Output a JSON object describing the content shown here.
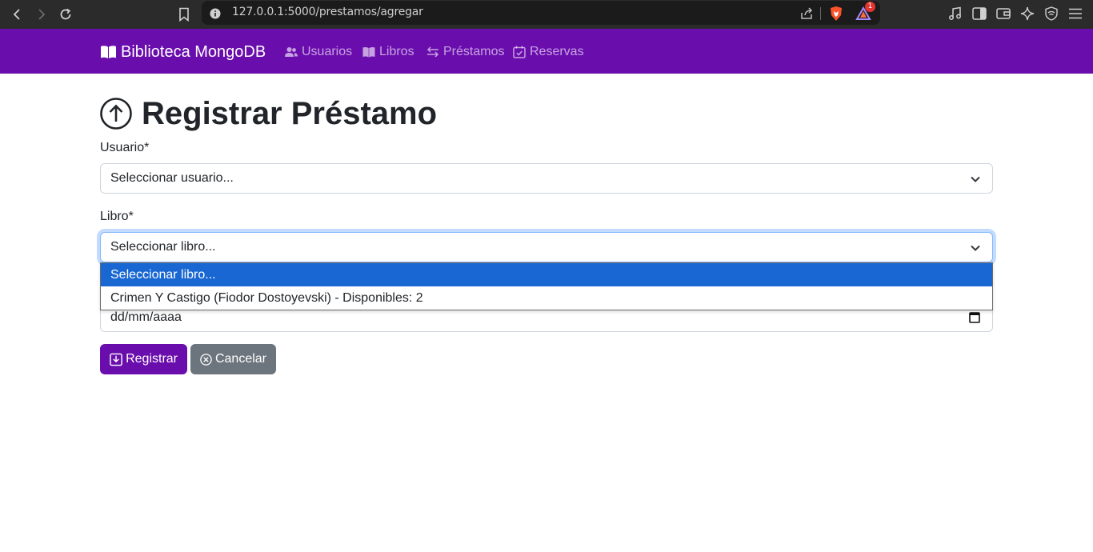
{
  "browser": {
    "url": "127.0.0.1:5000/prestamos/agregar",
    "notification_count": "1"
  },
  "navbar": {
    "brand": "Biblioteca MongoDB",
    "links": [
      {
        "label": "Usuarios",
        "icon": "users-icon"
      },
      {
        "label": "Libros",
        "icon": "book-icon"
      },
      {
        "label": "Préstamos",
        "icon": "arrows-exchange-icon"
      },
      {
        "label": "Reservas",
        "icon": "calendar-check-icon"
      }
    ],
    "colors": {
      "background": "#6a0dad",
      "text": "#ffffff"
    }
  },
  "page": {
    "title": "Registrar Préstamo",
    "title_icon": "arrow-up-circle-icon"
  },
  "form": {
    "usuario": {
      "label": "Usuario*",
      "selected": "Seleccionar usuario..."
    },
    "libro": {
      "label": "Libro*",
      "selected": "Seleccionar libro...",
      "options": [
        "Seleccionar libro...",
        "Crimen Y Castigo (Fiodor Dostoyevski) - Disponibles: 2"
      ],
      "highlighted_index": 0
    },
    "fecha": {
      "placeholder": "dd/mm/aaaa"
    },
    "buttons": {
      "submit": "Registrar",
      "cancel": "Cancelar"
    }
  },
  "colors": {
    "primary": "#6a0dad",
    "secondary": "#6c757d",
    "option_highlight": "#1967d2"
  }
}
